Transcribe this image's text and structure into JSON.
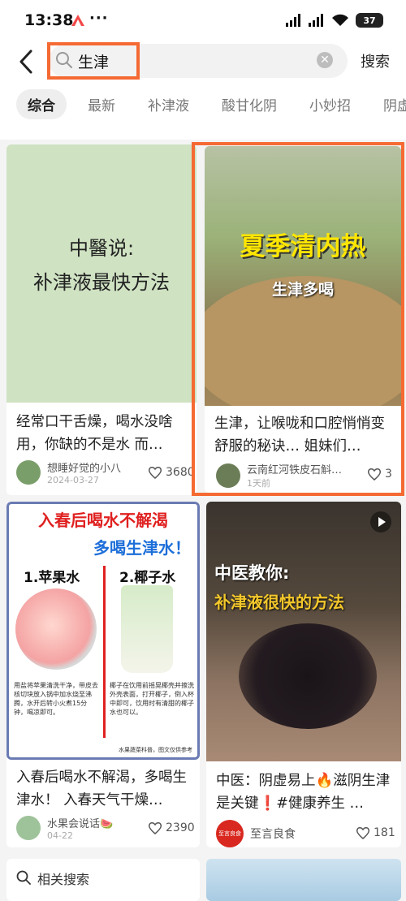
{
  "status_bar": {
    "time": "13:38",
    "more": "···",
    "battery": "37"
  },
  "search": {
    "query": "生津",
    "button": "搜索"
  },
  "tabs": [
    "综合",
    "最新",
    "补津液",
    "酸甘化阴",
    "小妙招",
    "阴虚火旺"
  ],
  "cards": [
    {
      "image_text": [
        "中醫说:",
        "补津液最快方法"
      ],
      "title": "经常口干舌燥，喝水没啥用，你缺的不是水 而…",
      "author": "想睡好觉的小八",
      "date": "2024-03-27",
      "likes": "3680"
    },
    {
      "image_text": [
        "夏季清内热",
        "生津多喝"
      ],
      "title": "生津，让喉咙和口腔悄悄变舒服的秘诀… 姐妹们…",
      "author": "云南红河铁皮石斛…",
      "date": "1天前",
      "likes": "3"
    },
    {
      "image_text": [
        "入春后喝水不解渴",
        "多喝生津水！",
        "1.苹果水",
        "2.椰子水",
        "用盐将苹果清洗干净，带皮去核切块放入锅中加水烧至沸腾，水开后转小火煮15分钟，喝凉即可。",
        "椰子在饮用前摇晃椰壳并擦洗外壳表面，打开椰子，倒入杯中即可，饮用时有清甜的椰子水也可以。",
        "水果蔬菜科普，图文仅供参考"
      ],
      "title": "入春后喝水不解渴，多喝生津水！ 入春天气干燥…",
      "author": "水果会说话🍉",
      "date": "04-22",
      "likes": "2390"
    },
    {
      "image_text": [
        "中医教你:",
        "补津液很快的方法"
      ],
      "title": "中医：阴虚易上🔥滋阴生津是关键❗#健康养生 …",
      "author": "至言良食",
      "avatar_text": "至言良食",
      "likes": "181"
    }
  ],
  "related": {
    "label": "相关搜索"
  },
  "colors": {
    "highlight": "#f56a33",
    "accent_red": "#e02020",
    "link_blue": "#1e6fd9"
  }
}
